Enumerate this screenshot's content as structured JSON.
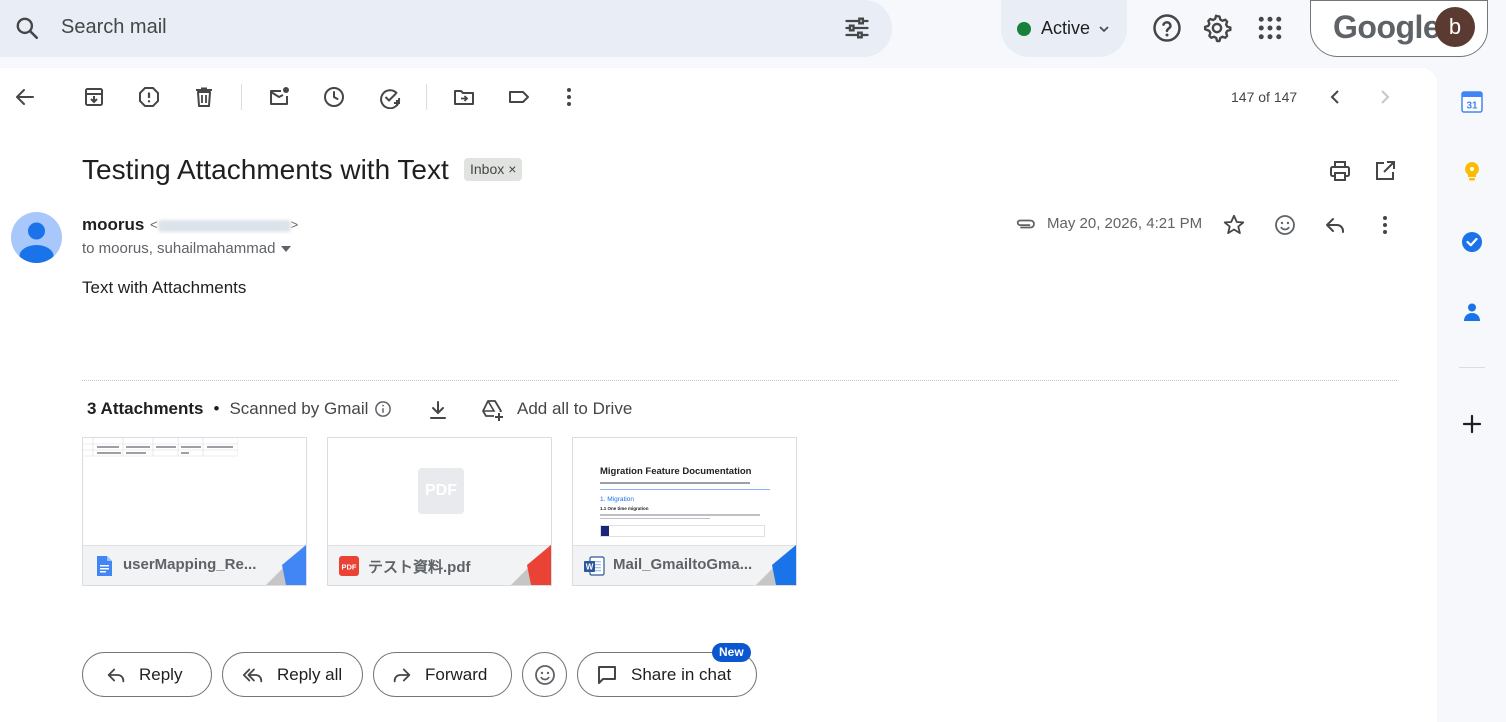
{
  "search": {
    "placeholder": "Search mail"
  },
  "status": {
    "label": "Active",
    "color": "#188038"
  },
  "account": {
    "brand": "Google",
    "avatar_letter": "b",
    "avatar_color": "#5b3a32"
  },
  "toolbar": {
    "icons": [
      "back-arrow-icon",
      "archive-icon",
      "report-spam-icon",
      "delete-icon",
      "mark-unread-icon",
      "snooze-icon",
      "add-to-tasks-icon",
      "move-to-icon",
      "label-icon",
      "more-vert-icon"
    ],
    "pagination": "147 of 147"
  },
  "email": {
    "subject": "Testing Attachments with Text",
    "label_chip": "Inbox",
    "chip_close": "×",
    "sender_name": "moorus",
    "email_open": "<",
    "email_close": ">",
    "recipients": "to moorus, suhailmahammad",
    "date": "May 20, 2026, 4:21 PM",
    "body": "Text with Attachments"
  },
  "attachments": {
    "count_label": "3 Attachments",
    "bullet": "•",
    "scanned_label": "Scanned by Gmail",
    "add_drive_label": "Add all to Drive",
    "items": [
      {
        "name": "userMapping_Re...",
        "type": "docs",
        "corner_color": "#4285f4"
      },
      {
        "name": "テスト資料.pdf",
        "type": "pdf",
        "preview_text": "PDF",
        "corner_color": "#ea4335"
      },
      {
        "name": "Mail_GmailtoGma...",
        "type": "word",
        "preview_title": "Migration Feature Documentation",
        "preview_heading": "1. Migration",
        "preview_subheading": "1.1 One time migration",
        "corner_color": "#1a73e8"
      }
    ]
  },
  "actions": {
    "reply": "Reply",
    "reply_all": "Reply all",
    "forward": "Forward",
    "share_chat": "Share in chat",
    "new_badge": "New"
  },
  "side_panel": {
    "calendar_day": "31",
    "icons": [
      "calendar-icon",
      "keep-icon",
      "tasks-icon",
      "contacts-icon",
      "add-icon"
    ]
  }
}
